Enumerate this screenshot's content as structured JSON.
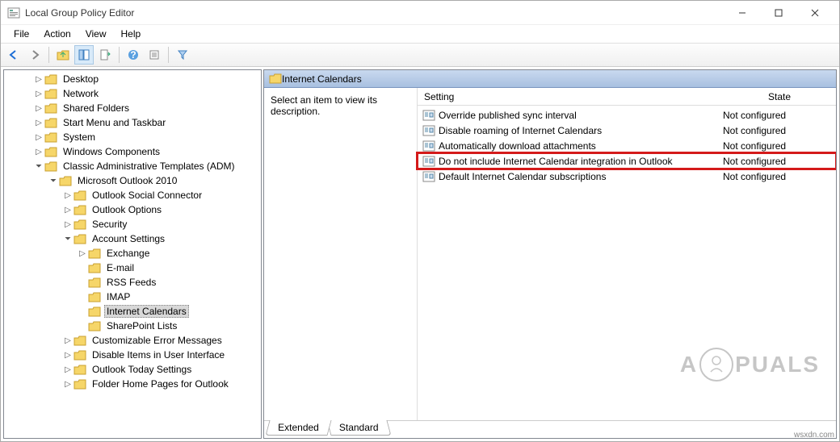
{
  "window": {
    "title": "Local Group Policy Editor"
  },
  "menu": {
    "file": "File",
    "action": "Action",
    "view": "View",
    "help": "Help"
  },
  "tree": [
    {
      "indent": 2,
      "exp": ">",
      "label": "Desktop"
    },
    {
      "indent": 2,
      "exp": ">",
      "label": "Network"
    },
    {
      "indent": 2,
      "exp": ">",
      "label": "Shared Folders"
    },
    {
      "indent": 2,
      "exp": ">",
      "label": "Start Menu and Taskbar"
    },
    {
      "indent": 2,
      "exp": ">",
      "label": "System"
    },
    {
      "indent": 2,
      "exp": ">",
      "label": "Windows Components"
    },
    {
      "indent": 2,
      "exp": "v",
      "label": "Classic Administrative Templates (ADM)"
    },
    {
      "indent": 3,
      "exp": "v",
      "label": "Microsoft Outlook 2010"
    },
    {
      "indent": 4,
      "exp": ">",
      "label": "Outlook Social Connector"
    },
    {
      "indent": 4,
      "exp": ">",
      "label": "Outlook Options"
    },
    {
      "indent": 4,
      "exp": ">",
      "label": "Security"
    },
    {
      "indent": 4,
      "exp": "v",
      "label": "Account Settings"
    },
    {
      "indent": 5,
      "exp": ">",
      "label": "Exchange"
    },
    {
      "indent": 5,
      "exp": "",
      "label": "E-mail"
    },
    {
      "indent": 5,
      "exp": "",
      "label": "RSS Feeds"
    },
    {
      "indent": 5,
      "exp": "",
      "label": "IMAP"
    },
    {
      "indent": 5,
      "exp": "",
      "label": "Internet Calendars",
      "selected": true
    },
    {
      "indent": 5,
      "exp": "",
      "label": "SharePoint Lists"
    },
    {
      "indent": 4,
      "exp": ">",
      "label": "Customizable Error Messages"
    },
    {
      "indent": 4,
      "exp": ">",
      "label": "Disable Items in User Interface"
    },
    {
      "indent": 4,
      "exp": ">",
      "label": "Outlook Today Settings"
    },
    {
      "indent": 4,
      "exp": ">",
      "label": "Folder Home Pages for Outlook"
    }
  ],
  "right": {
    "header": "Internet Calendars",
    "desc": "Select an item to view its description.",
    "col_setting": "Setting",
    "col_state": "State",
    "rows": [
      {
        "label": "Override published sync interval",
        "state": "Not configured"
      },
      {
        "label": "Disable roaming of Internet Calendars",
        "state": "Not configured"
      },
      {
        "label": "Automatically download attachments",
        "state": "Not configured"
      },
      {
        "label": "Do not include Internet Calendar integration in Outlook",
        "state": "Not configured",
        "highlight": true
      },
      {
        "label": "Default Internet Calendar subscriptions",
        "state": "Not configured"
      }
    ]
  },
  "tabs": {
    "extended": "Extended",
    "standard": "Standard"
  },
  "watermark": "A PUALS",
  "footer_url": "wsxdn.com"
}
